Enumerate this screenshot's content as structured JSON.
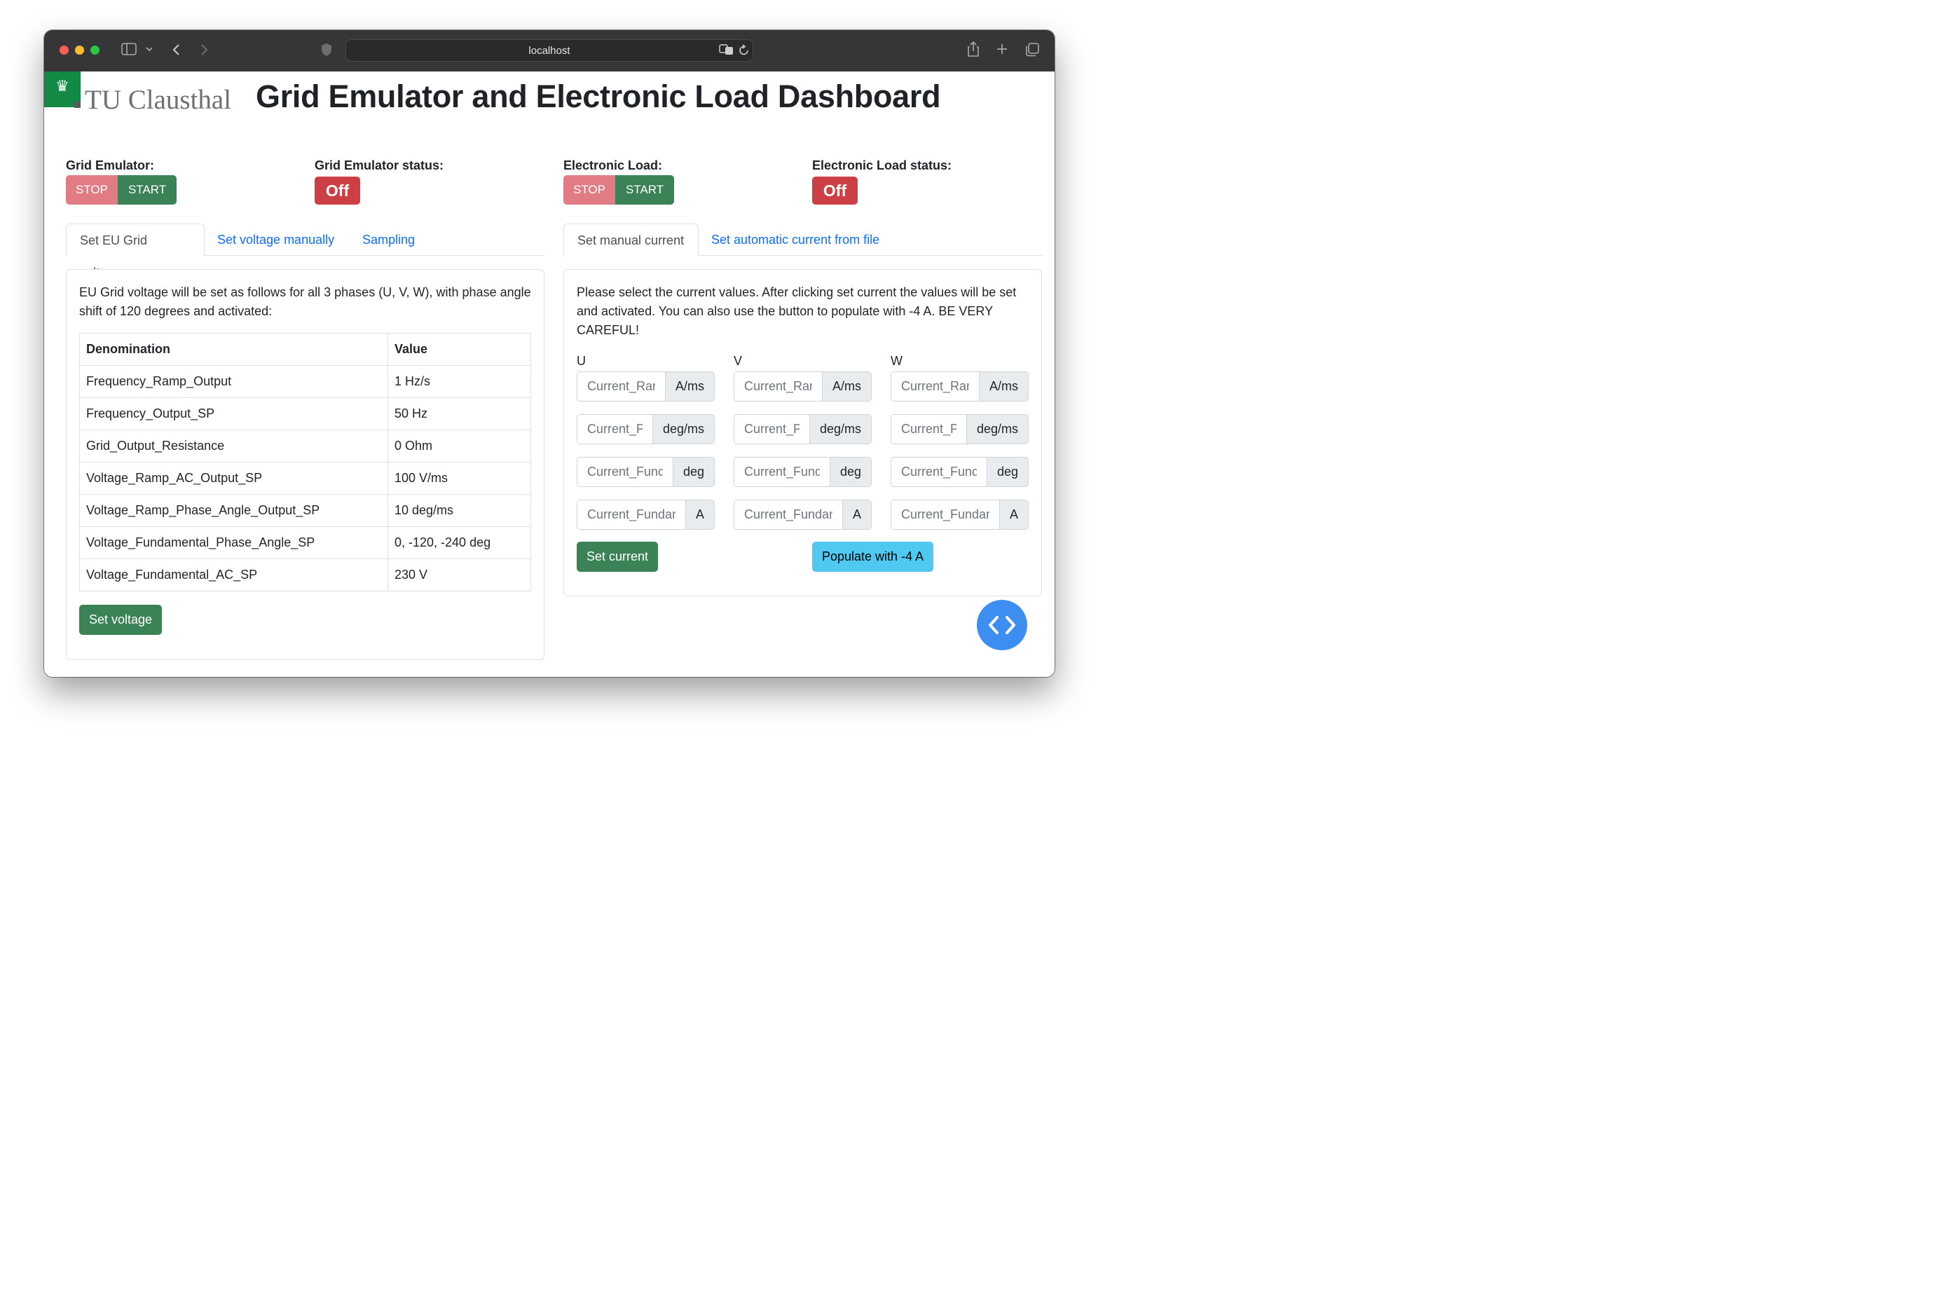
{
  "browser": {
    "url": "localhost",
    "icons": [
      "sidebar-icon",
      "chevron-down-icon",
      "back-icon",
      "forward-icon",
      "shield-icon",
      "translate-icon",
      "reload-icon",
      "share-icon",
      "new-tab-icon",
      "tabs-icon"
    ]
  },
  "header": {
    "logo_text": "TU Clausthal",
    "title": "Grid Emulator and Electronic Load Dashboard"
  },
  "grid_emulator": {
    "label": "Grid Emulator:",
    "stop": "STOP",
    "start": "START",
    "status_label": "Grid Emulator status:",
    "status": "Off"
  },
  "electronic_load": {
    "label": "Electronic Load:",
    "stop": "STOP",
    "start": "START",
    "status_label": "Electronic Load status:",
    "status": "Off"
  },
  "left_tabs": [
    "Set EU Grid voltage",
    "Set voltage manually",
    "Sampling"
  ],
  "right_tabs": [
    "Set manual current",
    "Set automatic current from file"
  ],
  "eu_grid": {
    "description": "EU Grid voltage will be set as follows for all 3 phases (U, V, W), with phase angle shift of 120 degrees and activated:",
    "columns": [
      "Denomination",
      "Value"
    ],
    "rows": [
      [
        "Frequency_Ramp_Output",
        "1 Hz/s"
      ],
      [
        "Frequency_Output_SP",
        "50 Hz"
      ],
      [
        "Grid_Output_Resistance",
        "0 Ohm"
      ],
      [
        "Voltage_Ramp_AC_Output_SP",
        "100 V/ms"
      ],
      [
        "Voltage_Ramp_Phase_Angle_Output_SP",
        "10 deg/ms"
      ],
      [
        "Voltage_Fundamental_Phase_Angle_SP",
        "0, -120, -240 deg"
      ],
      [
        "Voltage_Fundamental_AC_SP",
        "230 V"
      ]
    ],
    "button": "Set voltage"
  },
  "manual_current": {
    "description": "Please select the current values. After clicking set current the values will be set and activated. You can also use the button to populate with -4 A. BE VERY CAREFUL!",
    "phases": [
      "U",
      "V",
      "W"
    ],
    "fields": [
      {
        "placeholder": "Current_Ramp",
        "unit": "A/ms"
      },
      {
        "placeholder": "Current_Phase",
        "unit": "deg/ms"
      },
      {
        "placeholder": "Current_Fundamental",
        "unit": "deg"
      },
      {
        "placeholder": "Current_Fundamental",
        "unit": "A"
      }
    ],
    "set_button": "Set current",
    "populate_button": "Populate with -4 A"
  },
  "fab_icon": "code-icon",
  "colors": {
    "stop": "#e17c84",
    "start": "#3b8356",
    "status_off": "#cc3f45",
    "link": "#0d6efd",
    "populate": "#4fc8f2",
    "fab": "#3d8ef0",
    "logo_green": "#128a46"
  }
}
